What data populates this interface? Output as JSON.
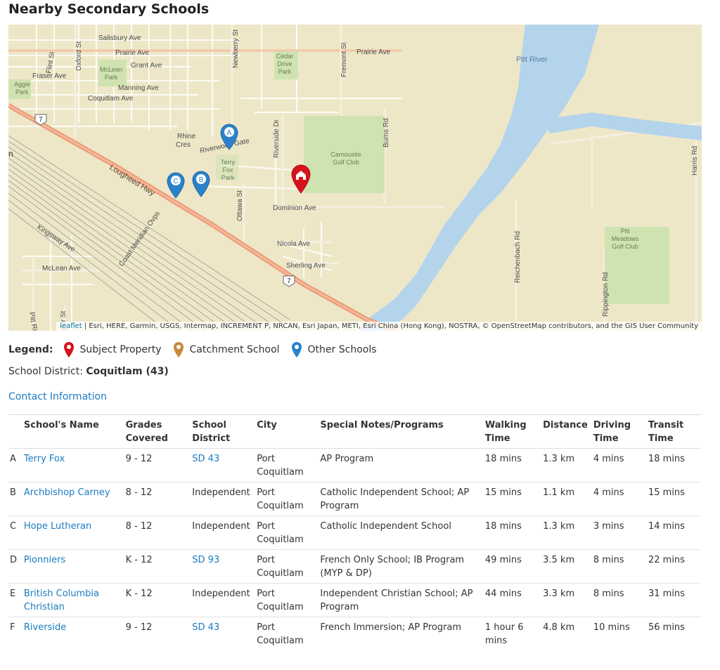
{
  "page": {
    "title": "Nearby Secondary Schools"
  },
  "map": {
    "attribution_link": "leaflet",
    "attribution_text": " | Esri, HERE, Garmin, USGS, Intermap, INCREMENT P, NRCAN, Esri Japan, METI, Esri China (Hong Kong), NOSTRA, © OpenStreetMap contributors, and the GIS User Community",
    "labels": {
      "salisbury": "Salisbury Ave",
      "prairie_w": "Prairie Ave",
      "prairie_e": "Prairie Ave",
      "grant": "Grant Ave",
      "fraser": "Fraser Ave",
      "manning": "Manning Ave",
      "coquitlam": "Coquitlam Ave",
      "flint": "Flint St",
      "oxford": "Oxford St",
      "newberry": "Newberry St",
      "fremont": "Fremont St",
      "cedar1": "Cedar",
      "cedar2": "Drive",
      "cedar3": "Park",
      "mclean_p1": "McLean",
      "mclean_p2": "Park",
      "aggie1": "Aggie",
      "aggie2": "Park",
      "pitt_river": "Pitt River",
      "burns": "Burns Rd",
      "riverside_dr": "Riverside Dr",
      "rhine1": "Rhine",
      "rhine2": "Cres",
      "riverwood": "Riverwood Gate",
      "terry1": "Terry",
      "terry2": "Fox",
      "terry3": "Park",
      "carnoustie1": "Carnoustie",
      "carnoustie2": "Golf Club",
      "lougheed": "Lougheed Hwy",
      "ottawa": "Ottawa St",
      "dominion": "Dominion Ave",
      "kingsway": "Kingsway Ave",
      "coast_meridian": "Coast Meridian Ovps",
      "nicola": "Nicola Ave",
      "sherling": "Sherling Ave",
      "mclean_ave": "McLean Ave",
      "pitt_river_rd": "Pitt River Rd",
      "taylor": "ylor St",
      "reichenbach": "Reichenbach Rd",
      "rippington": "Rippington Rd",
      "harris": "Harris Rd",
      "pitt_meadows1": "Pitt",
      "pitt_meadows2": "Meadows",
      "pitt_meadows3": "Golf Club",
      "hwy7a": "7",
      "hwy7b": "7",
      "edge_n": "n"
    },
    "markers": {
      "a": "A",
      "b": "B",
      "c": "C"
    },
    "colors": {
      "subject": "#d7131b",
      "catchment": "#c58a3d",
      "other": "#2b82cb",
      "water": "#b4d4ec",
      "land": "#eee7c7",
      "park": "#cfe3b0",
      "highway": "#ec9f7d"
    }
  },
  "legend": {
    "title": "Legend:",
    "items": [
      {
        "label": "Subject Property",
        "icon": "red-pin-icon"
      },
      {
        "label": "Catchment School",
        "icon": "orange-pin-icon"
      },
      {
        "label": "Other Schools",
        "icon": "blue-pin-icon"
      }
    ]
  },
  "district": {
    "label": "School District: ",
    "value": "Coquitlam (43)"
  },
  "contact_link": "Contact Information",
  "table": {
    "headers": {
      "name": "School's Name",
      "grades": "Grades Covered",
      "district": "School District",
      "city": "City",
      "notes": "Special Notes/Programs",
      "walking": "Walking Time",
      "distance": "Distance",
      "driving": "Driving Time",
      "transit": "Transit Time"
    },
    "rows": [
      {
        "label": "A",
        "name": "Terry Fox",
        "grades": "9 - 12",
        "district": "SD 43",
        "city": "Port Coquitlam",
        "notes": "AP Program",
        "walking": "18 mins",
        "distance": "1.3 km",
        "driving": "4 mins",
        "transit": "18 mins"
      },
      {
        "label": "B",
        "name": "Archbishop Carney",
        "grades": "8 - 12",
        "district": "Independent",
        "city": "Port Coquitlam",
        "notes": "Catholic Independent School; AP Program",
        "walking": "15 mins",
        "distance": "1.1 km",
        "driving": "4 mins",
        "transit": "15 mins"
      },
      {
        "label": "C",
        "name": "Hope Lutheran",
        "grades": "8 - 12",
        "district": "Independent",
        "city": "Port Coquitlam",
        "notes": "Catholic Independent School",
        "walking": "18 mins",
        "distance": "1.3 km",
        "driving": "3 mins",
        "transit": "14 mins"
      },
      {
        "label": "D",
        "name": "Pionniers",
        "grades": "K - 12",
        "district": "SD 93",
        "city": "Port Coquitlam",
        "notes": "French Only School; IB Program (MYP & DP)",
        "walking": "49 mins",
        "distance": "3.5 km",
        "driving": "8 mins",
        "transit": "22 mins"
      },
      {
        "label": "E",
        "name": "British Columbia Christian",
        "grades": "K - 12",
        "district": "Independent",
        "city": "Port Coquitlam",
        "notes": "Independent Christian School; AP Program",
        "walking": "44 mins",
        "distance": "3.3 km",
        "driving": "8 mins",
        "transit": "31 mins"
      },
      {
        "label": "F",
        "name": "Riverside",
        "grades": "9 - 12",
        "district": "SD 43",
        "city": "Port Coquitlam",
        "notes": "French Immersion; AP Program",
        "walking": "1 hour 6 mins",
        "distance": "4.8 km",
        "driving": "10 mins",
        "transit": "56 mins"
      }
    ]
  }
}
